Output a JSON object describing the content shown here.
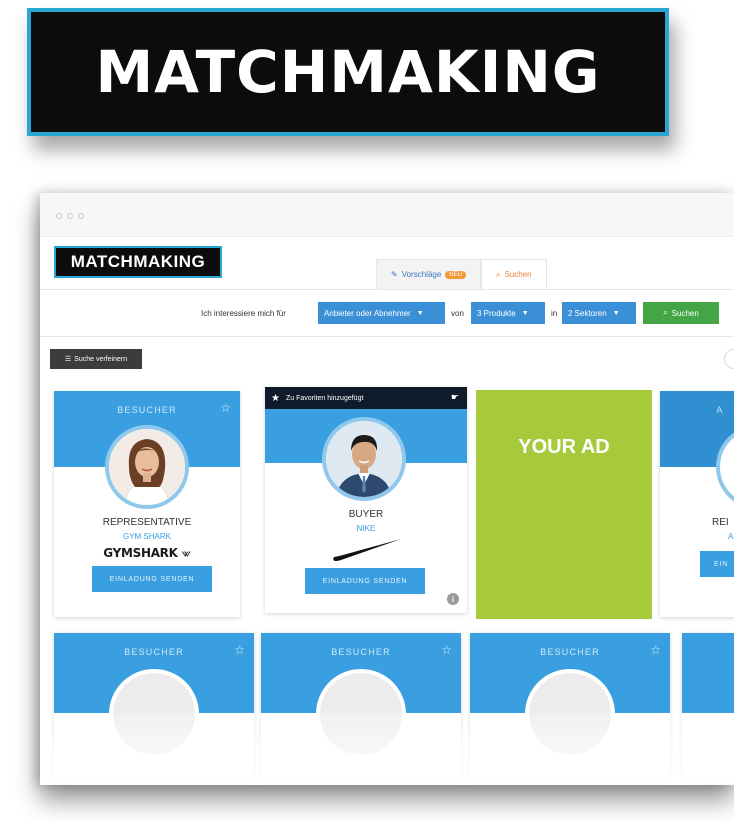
{
  "banner": {
    "title": "MATCHMAKING"
  },
  "app": {
    "logo": "MATCHMAKING",
    "tabs": [
      {
        "label": "Vorschläge",
        "badge": "NEU",
        "active": false
      },
      {
        "label": "Suchen",
        "active": true
      }
    ]
  },
  "search": {
    "prefix": "Ich interessiere mich für",
    "type_value": "Anbieter oder Abnehmer",
    "von": "von",
    "products_value": "3 Produkte",
    "in": "in",
    "sectors_value": "2 Sektoren",
    "button": "Suchen"
  },
  "refine_button": "Suche verfeinern",
  "cards": [
    {
      "role": "BESUCHER",
      "title": "REPRESENTATIVE",
      "company": "GYM SHARK",
      "logo_text": "GYMSHARK",
      "button": "EINLADUNG SENDEN"
    },
    {
      "favorite_note": "Zu Favoriten hinzugefügt",
      "title": "BUYER",
      "company": "NIKE",
      "button": "EINLADUNG SENDEN"
    },
    {
      "ad_text": "YOUR AD"
    },
    {
      "role": "A",
      "title": "REI",
      "company": "A",
      "button": "EIN"
    }
  ],
  "bottom_cards": [
    {
      "role": "BESUCHER"
    },
    {
      "role": "BESUCHER"
    },
    {
      "role": "BESUCHER"
    }
  ],
  "colors": {
    "accent_blue": "#3a9fe0",
    "banner_border": "#29a6d4",
    "search_green": "#44a547",
    "ad_green": "#a7c93c",
    "tab_orange": "#e8833a"
  }
}
